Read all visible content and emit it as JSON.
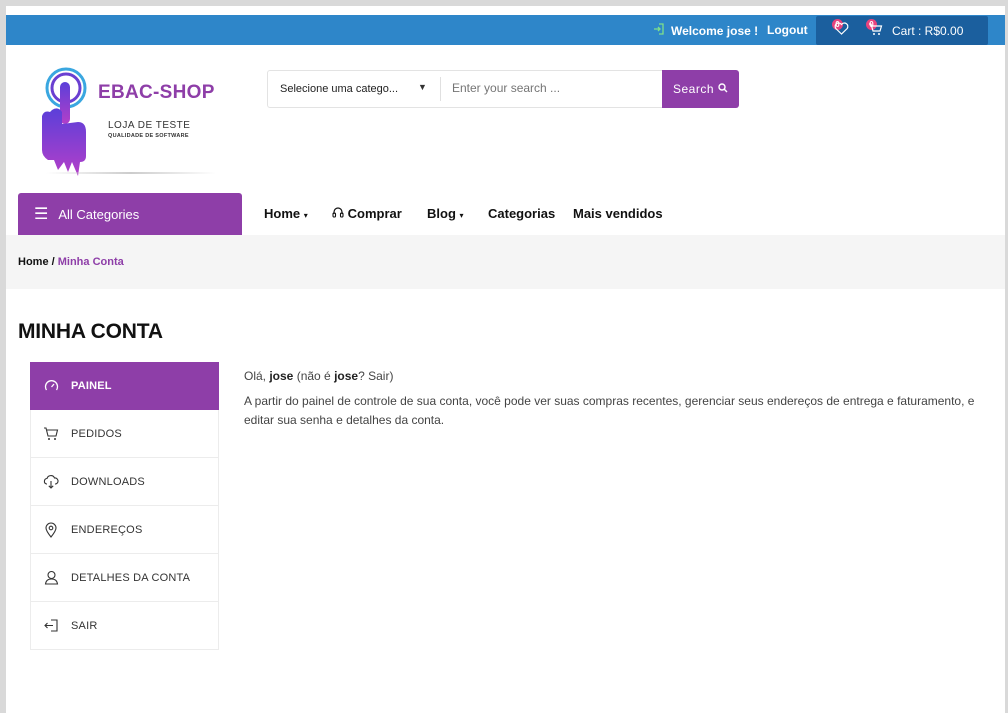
{
  "topbar": {
    "welcome": "Welcome jose !",
    "logout": "Logout",
    "wishlist_count": "0",
    "cart_count": "0",
    "cart_label": "Cart : R$0.00"
  },
  "logo": {
    "title": "EBAC-SHOP",
    "subtitle": "LOJA DE TESTE",
    "tagline": "QUALIDADE DE SOFTWARE"
  },
  "search": {
    "category_selected": "Selecione uma catego...",
    "placeholder": "Enter your search ...",
    "button_label": "Search"
  },
  "nav": {
    "all_categories": "All Categories",
    "items": [
      {
        "label": "Home"
      },
      {
        "label": "Comprar"
      },
      {
        "label": "Blog"
      },
      {
        "label": "Categorias"
      },
      {
        "label": "Mais vendidos"
      }
    ]
  },
  "breadcrumb": {
    "home": "Home",
    "separator": " / ",
    "current": "Minha Conta"
  },
  "page_title": "MINHA CONTA",
  "account_menu": [
    {
      "label": "PAINEL",
      "icon": "dashboard-icon",
      "active": true
    },
    {
      "label": "PEDIDOS",
      "icon": "cart-icon",
      "active": false
    },
    {
      "label": "DOWNLOADS",
      "icon": "cloud-download-icon",
      "active": false
    },
    {
      "label": "ENDEREÇOS",
      "icon": "map-pin-icon",
      "active": false
    },
    {
      "label": "DETALHES DA CONTA",
      "icon": "user-icon",
      "active": false
    },
    {
      "label": "SAIR",
      "icon": "logout-icon",
      "active": false
    }
  ],
  "content": {
    "greet_prefix": "Olá, ",
    "user": "jose",
    "greet_mid": " (não é ",
    "user2": "jose",
    "greet_q": "? ",
    "sair": "Sair",
    "greet_end": ")",
    "paragraph": "A partir do painel de controle de sua conta, você pode ver suas compras recentes, gerenciar seus endereços de entrega e faturamento, e editar sua senha e detalhes da conta."
  },
  "colors": {
    "brand_purple": "#8e3ea8",
    "topbar_blue": "#2e86c9",
    "cart_blue": "#1b5f9e",
    "badge_pink": "#e8437e"
  }
}
